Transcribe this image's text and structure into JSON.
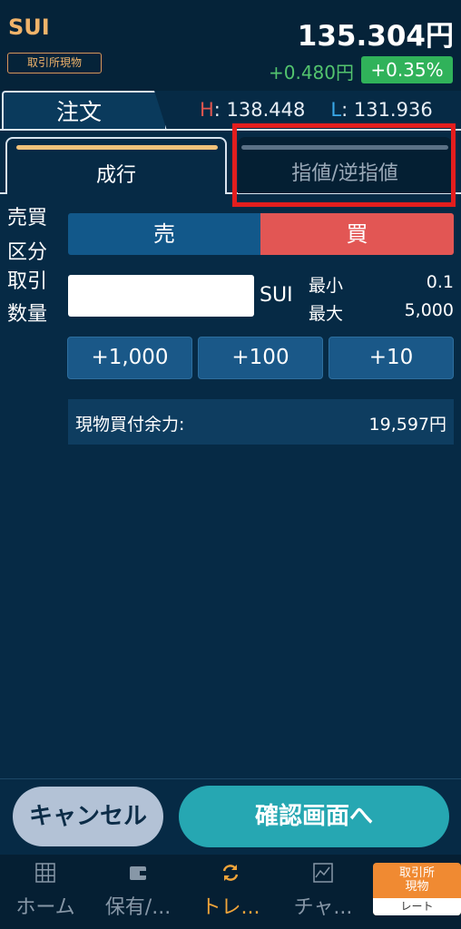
{
  "header": {
    "symbol": "SUI",
    "market_badge": "取引所現物",
    "price": "135.304円",
    "change": "+0.480円",
    "change_pct": "+0.35%"
  },
  "order_tab": {
    "label": "注文",
    "high_key": "H",
    "high_value": ": 138.448",
    "low_key": "L",
    "low_value": ": 131.936"
  },
  "order_types": {
    "market": "成行",
    "limit": "指値/逆指値"
  },
  "form": {
    "side_label_1": "売買",
    "side_label_2": "区分",
    "qty_label_1": "取引",
    "qty_label_2": "数量",
    "sell": "売",
    "buy": "買",
    "quantity_value": "",
    "unit": "SUI",
    "min_label": "最小",
    "min_value": "0.1",
    "max_label": "最大",
    "max_value": "5,000",
    "increments": [
      "+1,000",
      "+100",
      "+10"
    ],
    "buying_power_label": "現物買付余力:",
    "buying_power_value": "19,597円"
  },
  "actions": {
    "cancel": "キャンセル",
    "confirm": "確認画面へ"
  },
  "nav": {
    "items": [
      {
        "label": "ホーム",
        "icon": "grid-icon"
      },
      {
        "label": "保有/...",
        "icon": "wallet-icon"
      },
      {
        "label": "トレ...",
        "icon": "refresh-icon"
      },
      {
        "label": "チャ...",
        "icon": "chart-icon"
      }
    ],
    "active_index": 2,
    "rate_button_top": "取引所\n現物",
    "rate_button_bottom": "レート"
  }
}
